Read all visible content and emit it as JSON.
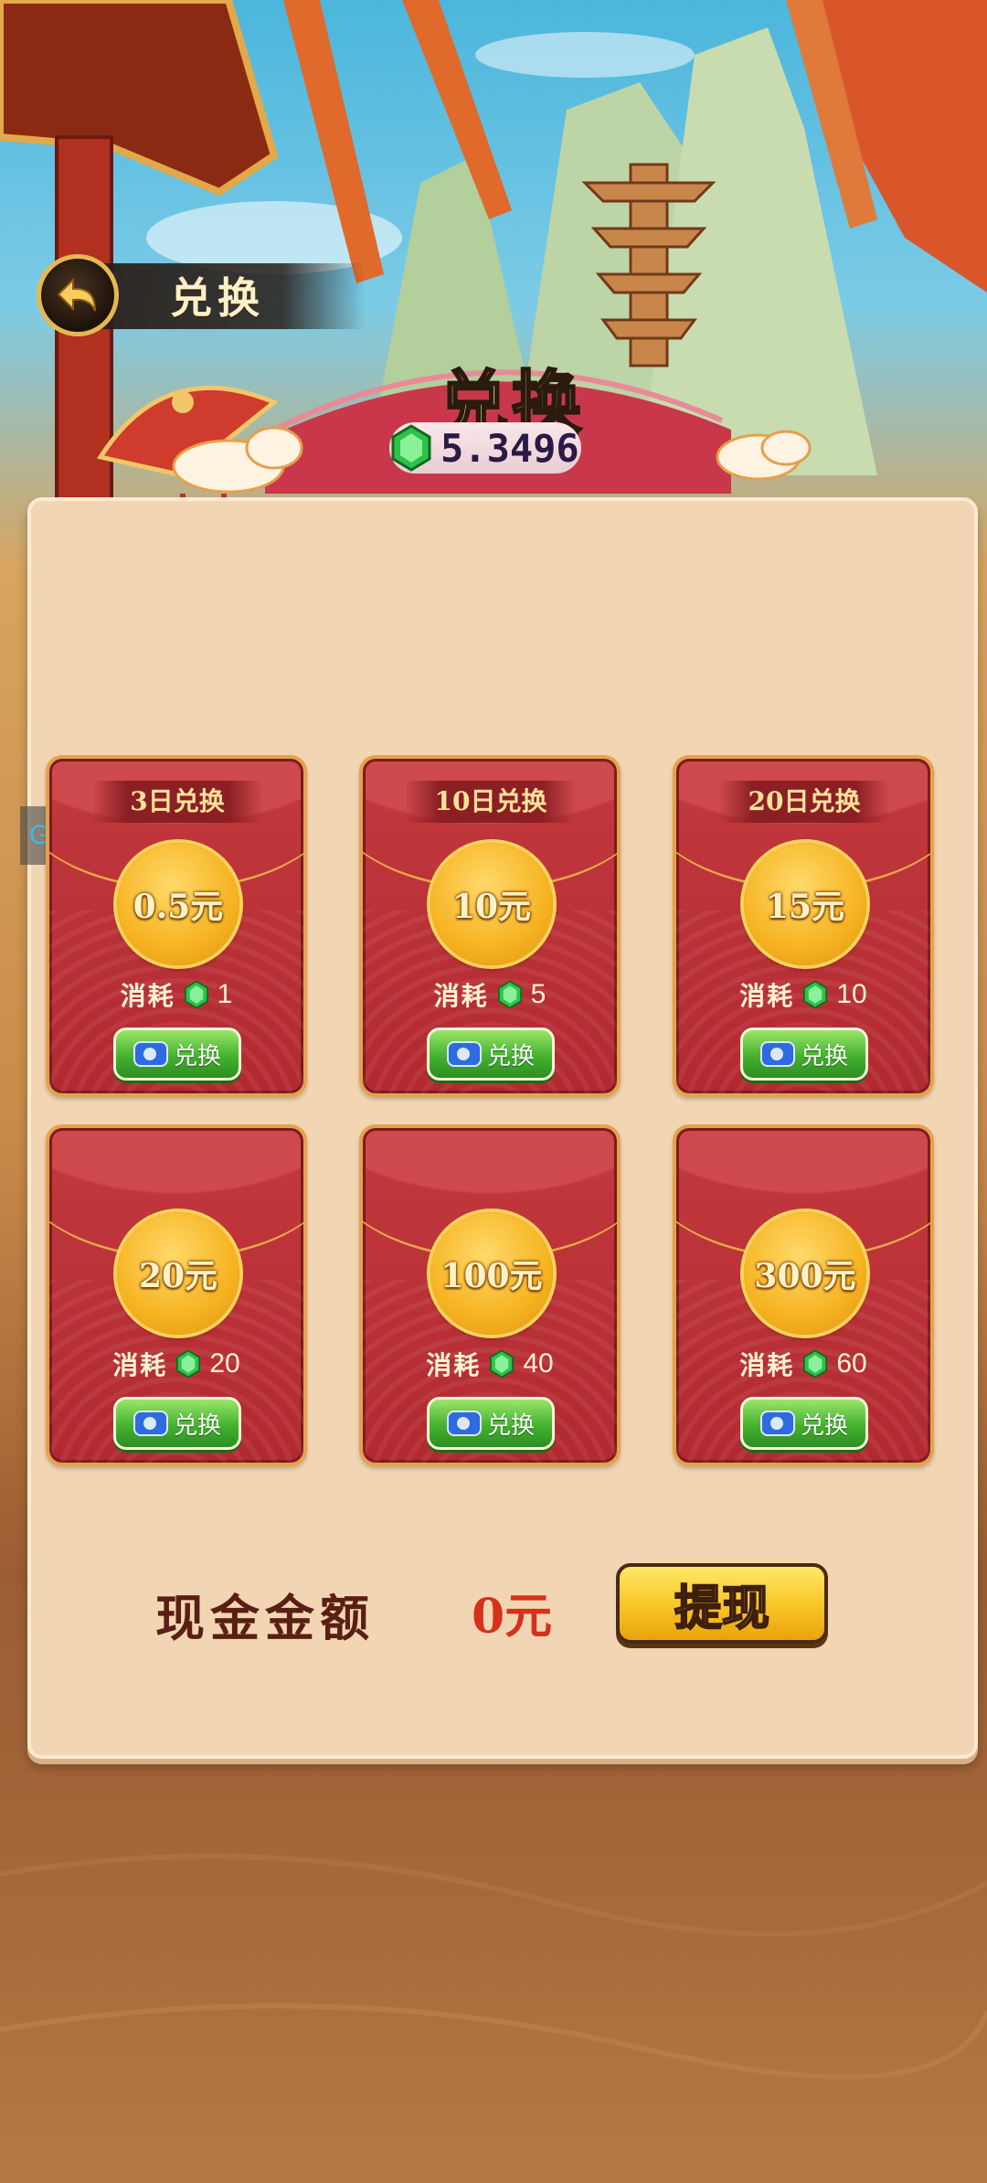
{
  "header": {
    "back_title": "兑换",
    "banner_title": "兑换",
    "gem_balance": "5.3496"
  },
  "gm_badge": "GM",
  "cards": [
    {
      "tag": "3日兑换",
      "amount": "0.5元",
      "cost_label": "消耗",
      "cost": "1",
      "button": "兑换"
    },
    {
      "tag": "10日兑换",
      "amount": "10元",
      "cost_label": "消耗",
      "cost": "5",
      "button": "兑换"
    },
    {
      "tag": "20日兑换",
      "amount": "15元",
      "cost_label": "消耗",
      "cost": "10",
      "button": "兑换"
    },
    {
      "tag": "",
      "amount": "20元",
      "cost_label": "消耗",
      "cost": "20",
      "button": "兑换"
    },
    {
      "tag": "",
      "amount": "100元",
      "cost_label": "消耗",
      "cost": "40",
      "button": "兑换"
    },
    {
      "tag": "",
      "amount": "300元",
      "cost_label": "消耗",
      "cost": "60",
      "button": "兑换"
    }
  ],
  "cash": {
    "label": "现金金额",
    "value": "0元",
    "withdraw_label": "提现"
  },
  "colors": {
    "card_red": "#c23a3e",
    "gold": "#f6b321",
    "green_button": "#43b22e",
    "panel": "#f2d6b3",
    "cash_value": "#d6301e"
  },
  "icons": [
    "back-arrow-icon",
    "green-gem-icon",
    "video-camera-icon",
    "red-fan-icon",
    "cloud-icon"
  ]
}
